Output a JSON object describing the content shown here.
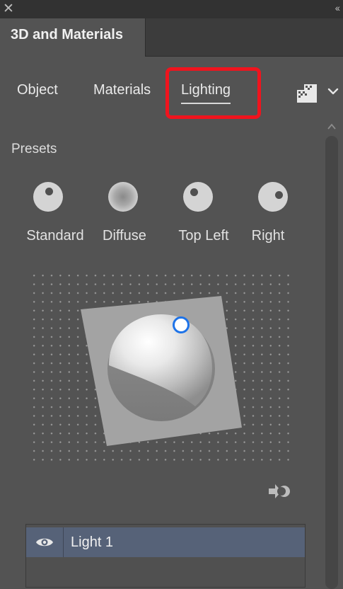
{
  "window": {
    "close_glyph": "✕",
    "collapse_glyph": "‹‹"
  },
  "panel": {
    "title": "3D and Materials"
  },
  "tabs": [
    {
      "label": "Object",
      "active": false
    },
    {
      "label": "Materials",
      "active": false
    },
    {
      "label": "Lighting",
      "active": true
    }
  ],
  "toolbar": {
    "render_icon": "render-settings-icon",
    "menu_icon": "chevron-down-icon"
  },
  "presets": {
    "label": "Presets",
    "items": [
      {
        "label": "Standard",
        "icon": "preset-standard-icon"
      },
      {
        "label": "Diffuse",
        "icon": "preset-diffuse-icon"
      },
      {
        "label": "Top Left",
        "icon": "preset-top-left-icon"
      },
      {
        "label": "Right",
        "icon": "preset-right-icon"
      }
    ]
  },
  "lights": [
    {
      "name": "Light 1",
      "visible": true,
      "selected": true
    }
  ],
  "colors": {
    "panel_bg": "#535353",
    "selection": "#566278",
    "handle": "#1e73e8",
    "highlight": "#f0141e"
  }
}
